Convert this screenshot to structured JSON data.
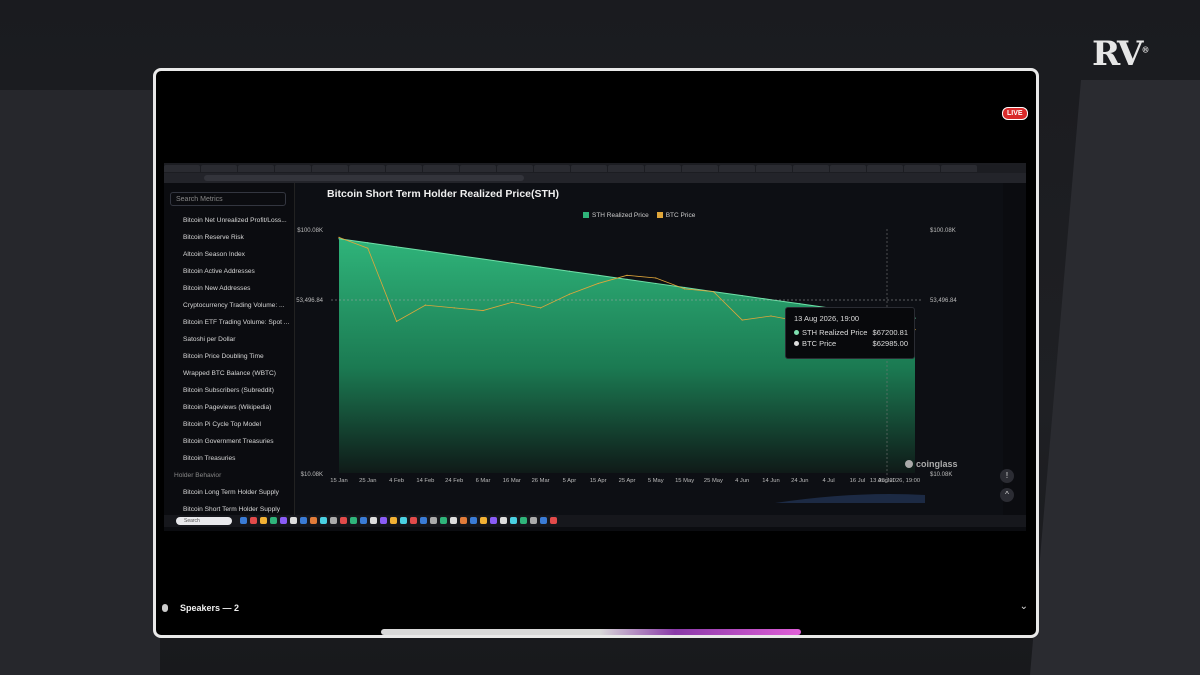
{
  "branding": {
    "logo_text": "RV",
    "logo_mark": "®",
    "live_badge": "LIVE"
  },
  "sidebar": {
    "search_placeholder": "Search Metrics",
    "items": [
      "Bitcoin Net Unrealized Profit/Loss...",
      "Bitcoin Reserve Risk",
      "Altcoin Season Index",
      "Bitcoin Active Addresses",
      "Bitcoin New Addresses",
      "Cryptocurrency Trading Volume: ...",
      "Bitcoin ETF Trading Volume: Spot ...",
      "Satoshi per Dollar",
      "Bitcoin Price Doubling Time",
      "Wrapped BTC Balance (WBTC)",
      "Bitcoin Subscribers (Subreddit)",
      "Bitcoin Pageviews (Wikipedia)",
      "Bitcoin Pi Cycle Top Model",
      "Bitcoin Government Treasuries",
      "Bitcoin Treasuries"
    ],
    "group_label": "Holder Behavior",
    "group_items": [
      "Bitcoin Long Term Holder Supply",
      "Bitcoin Short Term Holder Supply"
    ]
  },
  "chart_data": {
    "type": "area",
    "title": "Bitcoin Short Term Holder Realized Price(STH)",
    "series": [
      {
        "name": "STH Realized Price",
        "color": "#2fb47a",
        "x": [
          "15 Jan",
          "25 Jan",
          "4 Feb",
          "14 Feb",
          "24 Feb",
          "6 Mar",
          "16 Mar",
          "26 Mar",
          "5 Apr",
          "15 Apr",
          "25 Apr",
          "5 May",
          "15 May",
          "25 May",
          "4 Jun",
          "14 Jun",
          "24 Jun",
          "4 Jul",
          "16 Jul",
          "26 Jul",
          "13 Aug 2026, 19:00"
        ],
        "values": [
          96500,
          95000,
          93500,
          92000,
          90500,
          89000,
          87500,
          86000,
          84500,
          83000,
          81500,
          80000,
          78500,
          77000,
          75500,
          74000,
          72500,
          71000,
          69500,
          68300,
          67200.81
        ]
      },
      {
        "name": "BTC Price",
        "color": "#e0a63a",
        "x": [
          "15 Jan",
          "25 Jan",
          "4 Feb",
          "14 Feb",
          "24 Feb",
          "6 Mar",
          "16 Mar",
          "26 Mar",
          "5 Apr",
          "15 Apr",
          "25 Apr",
          "5 May",
          "15 May",
          "25 May",
          "4 Jun",
          "14 Jun",
          "24 Jun",
          "4 Jul",
          "16 Jul",
          "26 Jul",
          "13 Aug 2026, 19:00"
        ],
        "values": [
          97000,
          93000,
          66000,
          72000,
          71000,
          70000,
          73000,
          71000,
          76000,
          80000,
          83000,
          82000,
          78000,
          77000,
          66500,
          68000,
          66000,
          64000,
          66500,
          67500,
          62985.0
        ]
      }
    ],
    "x_ticks": [
      "15 Jan",
      "25 Jan",
      "4 Feb",
      "14 Feb",
      "24 Feb",
      "6 Mar",
      "16 Mar",
      "26 Mar",
      "5 Apr",
      "15 Apr",
      "25 Apr",
      "5 May",
      "15 May",
      "25 May",
      "4 Jun",
      "14 Jun",
      "24 Jun",
      "4 Jul",
      "16 Jul",
      "26 Jul",
      "13 Aug 2026, 19:00"
    ],
    "y_ticks_left": [
      "$100.08K",
      "$10.08K"
    ],
    "y_ticks_right": [
      "$100.08K",
      "$10.08K"
    ],
    "crosshair_value": "53,496.84",
    "tooltip": {
      "date": "13 Aug 2026, 19:00",
      "rows": [
        {
          "label": "STH Realized Price",
          "value": "$67200.81"
        },
        {
          "label": "BTC Price",
          "value": "$62985.00"
        }
      ]
    },
    "ylim": [
      10080,
      100080
    ],
    "legend_position": "top-center"
  },
  "watermark": "coinglass",
  "footer": {
    "speakers": "Speakers — 2"
  },
  "taskbar": {
    "search": "Search"
  },
  "colors": {
    "accent": "#2fb47a",
    "btc": "#e0a63a",
    "live": "#d92b2b"
  }
}
